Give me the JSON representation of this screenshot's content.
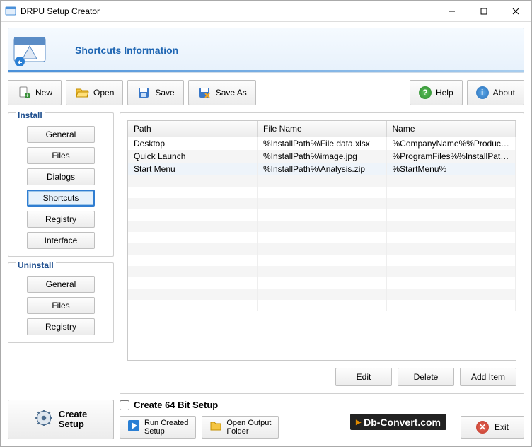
{
  "window": {
    "title": "DRPU Setup Creator"
  },
  "banner": {
    "title": "Shortcuts Information"
  },
  "toolbar": {
    "new": "New",
    "open": "Open",
    "save": "Save",
    "saveas": "Save As",
    "help": "Help",
    "about": "About"
  },
  "sidebar": {
    "install": {
      "title": "Install",
      "items": [
        "General",
        "Files",
        "Dialogs",
        "Shortcuts",
        "Registry",
        "Interface"
      ],
      "selected": 3
    },
    "uninstall": {
      "title": "Uninstall",
      "items": [
        "General",
        "Files",
        "Registry"
      ]
    }
  },
  "table": {
    "headers": [
      "Path",
      "File Name",
      "Name"
    ],
    "rows": [
      {
        "path": "Desktop",
        "file": "%InstallPath%\\File data.xlsx",
        "name": "%CompanyName%%ProductName%"
      },
      {
        "path": "Quick Launch",
        "file": "%InstallPath%\\image.jpg",
        "name": "%ProgramFiles%%InstallPath%"
      },
      {
        "path": "Start Menu",
        "file": "%InstallPath%\\Analysis.zip",
        "name": "%StartMenu%"
      }
    ]
  },
  "actions": {
    "edit": "Edit",
    "delete": "Delete",
    "add": "Add Item"
  },
  "footer": {
    "create": "Create\nSetup",
    "check64": "Create 64 Bit Setup",
    "run": "Run Created\nSetup",
    "openout": "Open Output\nFolder",
    "exit": "Exit"
  },
  "watermark": "Db-Convert.com"
}
